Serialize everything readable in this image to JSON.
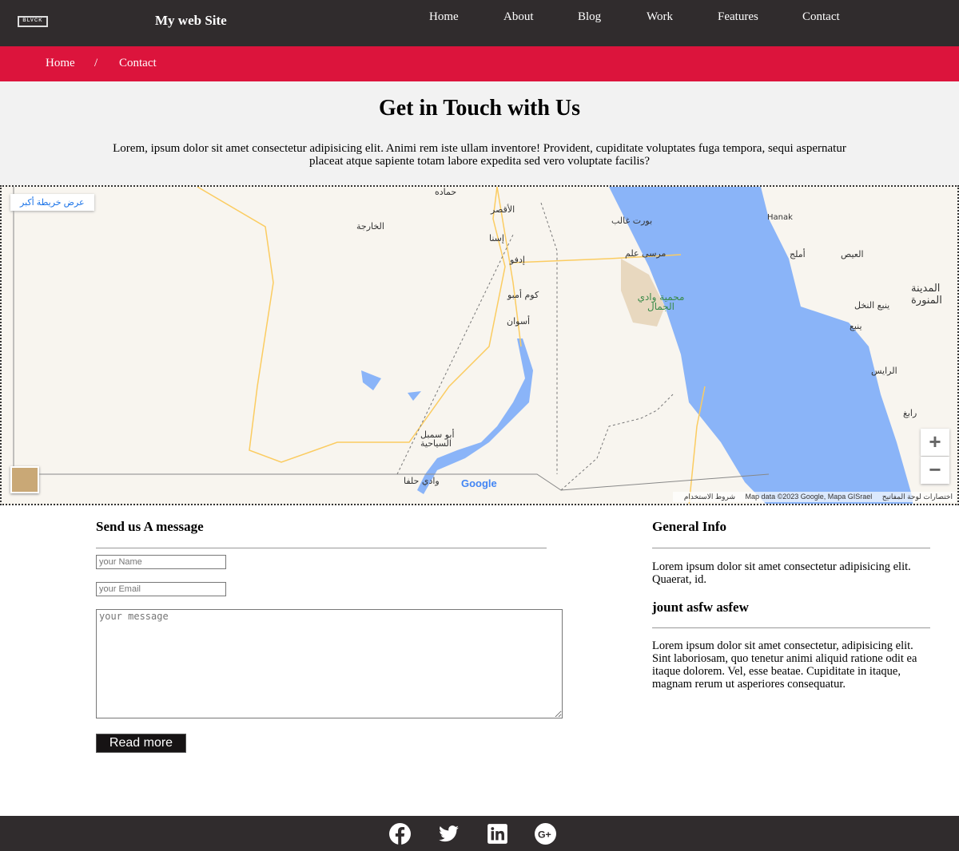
{
  "header": {
    "logo": "BLVCK",
    "site_title": "My web Site",
    "nav": [
      "Home",
      "About",
      "Blog",
      "Work",
      "Features",
      "Contact"
    ]
  },
  "breadcrumb": {
    "home": "Home",
    "sep": "/",
    "current": "Contact"
  },
  "hero": {
    "title": "Get in Touch with Us",
    "text": "Lorem, ipsum dolor sit amet consectetur adipisicing elit. Animi rem iste ullam inventore! Provident, cupiditate voluptates fuga tempora, sequi aspernatur placeat atque sapiente totam labore expedita sed vero voluptate facilis?"
  },
  "map": {
    "larger_map": "عرض خريطة أكبر",
    "zoom_in": "+",
    "zoom_out": "−",
    "google": "Google",
    "shortcuts": "اختصارات لوحة المفاتيح",
    "map_data": "Map data ©2023 Google, Mapa GISrael",
    "terms": "شروط الاستخدام",
    "labels": [
      "الخارجة",
      "الأقصر",
      "إسنا",
      "إدفو",
      "كوم أمبو",
      "أسوان",
      "أبو سمبل السياحية",
      "وادي حلفا",
      "Hanak",
      "أملج",
      "العيص",
      "المدينة المنورة",
      "ينبع النخل",
      "ينبع",
      "الرايس",
      "رابغ",
      "مرسى علم",
      "بورت غالب",
      "محمية وادي الجمال",
      "حماده"
    ]
  },
  "form": {
    "title": "Send us A message",
    "name_placeholder": "your Name",
    "email_placeholder": "your Email",
    "message_placeholder": "your message",
    "button": "Read more"
  },
  "info": {
    "title": "General Info",
    "text1": "Lorem ipsum dolor sit amet consectetur adipisicing elit. Quaerat, id.",
    "subtitle": "jount asfw asfew",
    "text2": "Lorem ipsum dolor sit amet consectetur, adipisicing elit. Sint laboriosam, quo tenetur animi aliquid ratione odit ea itaque dolorem. Vel, esse beatae. Cupiditate in itaque, magnam rerum ut asperiores consequatur."
  },
  "colors": {
    "dark": "#302c2d",
    "accent": "#dc143c",
    "water": "#8ab4f8"
  }
}
